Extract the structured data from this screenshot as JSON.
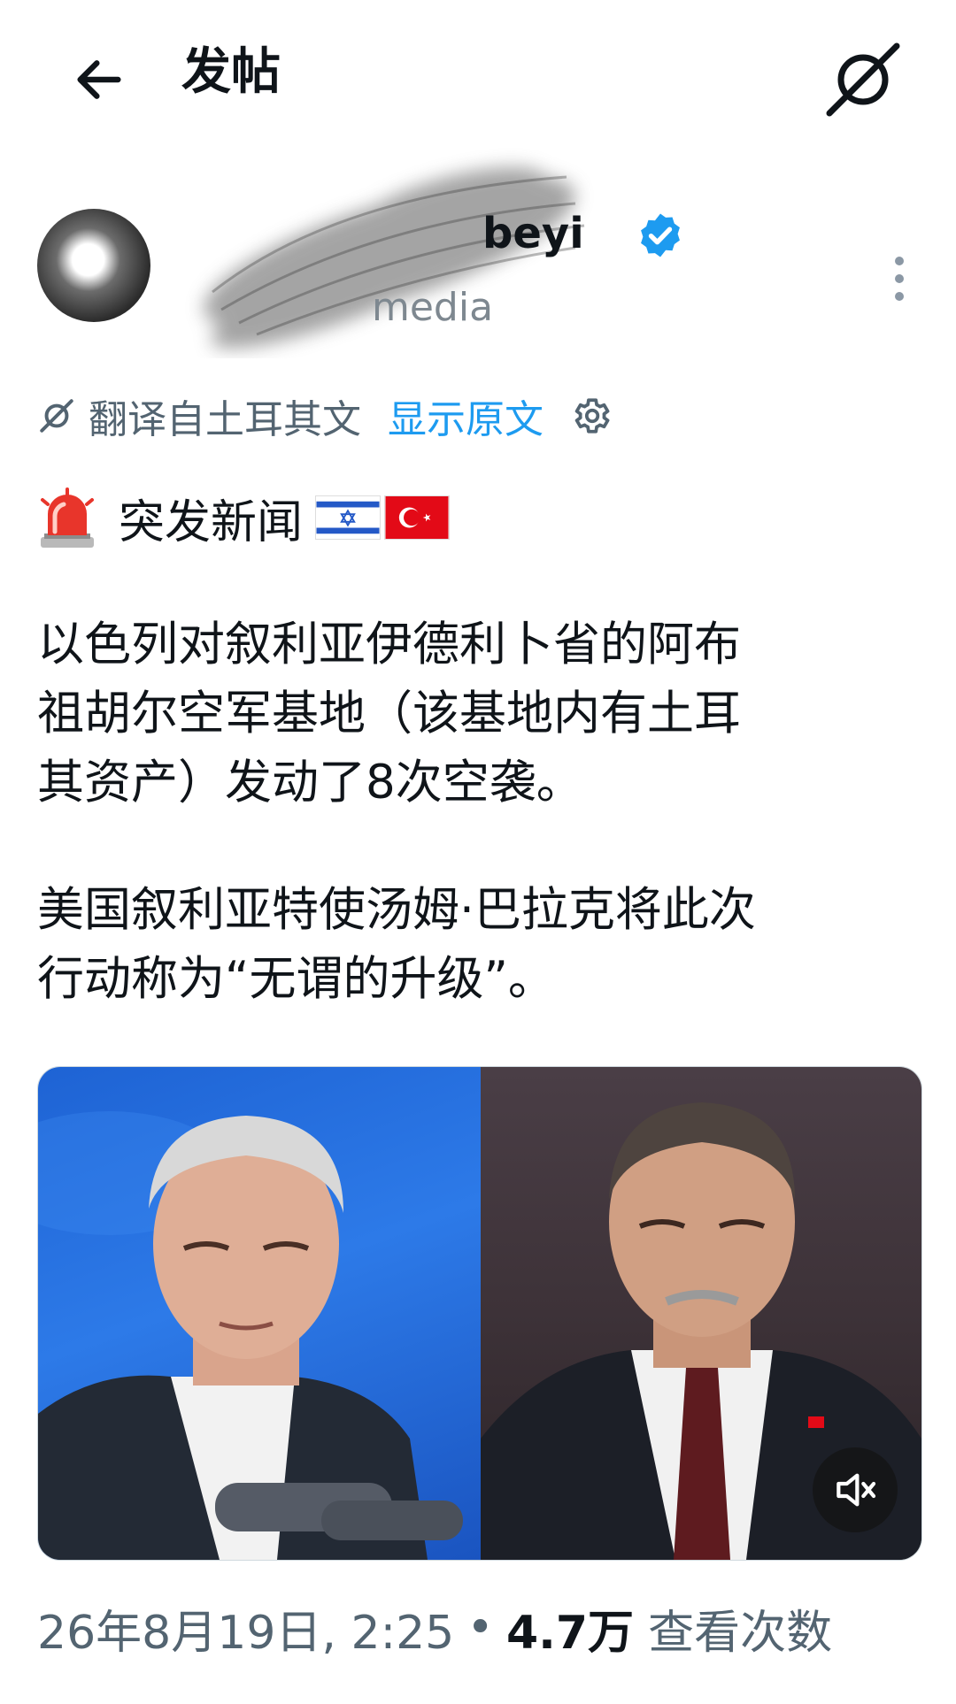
{
  "header": {
    "title": "发帖"
  },
  "author": {
    "name": "beyi",
    "handle": "media"
  },
  "translation": {
    "label": "翻译自土耳其文",
    "show_original": "显示原文"
  },
  "headline": {
    "text": "突发新闻"
  },
  "body": {
    "paragraph_1": "以色列对叙利亚伊德利卜省的阿布\n祖胡尔空军基地（该基地内有土耳\n其资产）发动了8次空袭。",
    "paragraph_2": "美国叙利亚特使汤姆·巴拉克将此次\n行动称为“无谓的升级”。"
  },
  "meta": {
    "datetime": "26年8月19日, 2:25",
    "separator": "•",
    "view_count": "4.7万",
    "views_label": "查看次数"
  },
  "icons": {
    "back": "arrow-left-icon",
    "grok": "grok-icon",
    "verified": "verified-badge-icon",
    "more": "more-vertical-icon",
    "translate": "grok-icon",
    "settings": "gear-icon",
    "siren": "siren-emoji",
    "flags": [
      "israel-flag",
      "turkey-flag"
    ],
    "mute": "volume-mute-icon"
  },
  "colors": {
    "link": "#1d9bf0",
    "secondary_text": "#536471",
    "verified": "#1d9bf0",
    "text": "#0f1419"
  }
}
